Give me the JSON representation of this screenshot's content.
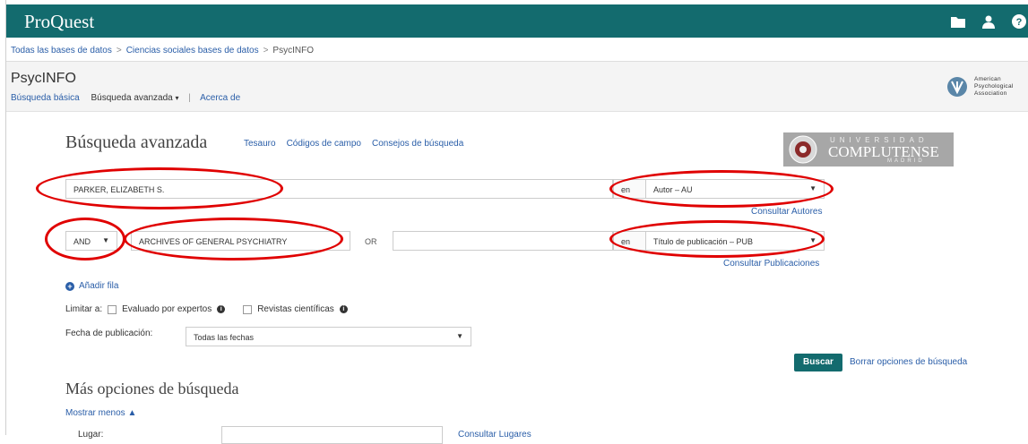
{
  "app": {
    "logo": "ProQuest"
  },
  "breadcrumb": {
    "items": [
      "Todas las bases de datos",
      "Ciencias sociales bases de datos"
    ],
    "current": "PsycINFO",
    "separator": ">"
  },
  "database": {
    "title": "PsycINFO",
    "nav": {
      "basic": "Búsqueda básica",
      "advanced": "Búsqueda avanzada",
      "about": "Acerca de",
      "divider": "|"
    }
  },
  "apa_logo": {
    "lines": [
      "American",
      "Psychological",
      "Association"
    ]
  },
  "search": {
    "heading": "Búsqueda avanzada",
    "links": [
      "Tesauro",
      "Códigos de campo",
      "Consejos de búsqueda"
    ],
    "rows": [
      {
        "boolean": "",
        "term": "PARKER, ELIZABETH S.",
        "in_label": "en",
        "field": "Autor – AU",
        "consult": "Consultar Autores"
      },
      {
        "boolean": "AND",
        "term": "ARCHIVES OF GENERAL PSYCHIATRY",
        "or_label": "OR",
        "term2": "",
        "in_label": "en",
        "field": "Título de publicación – PUB",
        "consult": "Consultar Publicaciones"
      }
    ],
    "add_row": "Añadir fila",
    "limit": {
      "label": "Limitar a:",
      "options": [
        "Evaluado por expertos",
        "Revistas científicas"
      ]
    },
    "date": {
      "label": "Fecha de publicación:",
      "value": "Todas las fechas"
    },
    "submit": "Buscar",
    "clear": "Borrar opciones de búsqueda"
  },
  "university_logo": {
    "top": "UNIVERSIDAD",
    "main": "COMPLUTENSE",
    "bottom": "MADRID"
  },
  "more_options": {
    "heading": "Más opciones de búsqueda",
    "toggle": "Mostrar menos ▲",
    "place_label": "Lugar:",
    "place_link": "Consultar Lugares"
  },
  "colors": {
    "brand": "#136b6e",
    "link": "#2a5ea8",
    "annotation": "#e00000"
  },
  "icons": [
    "folder-icon",
    "user-icon",
    "help-icon"
  ]
}
